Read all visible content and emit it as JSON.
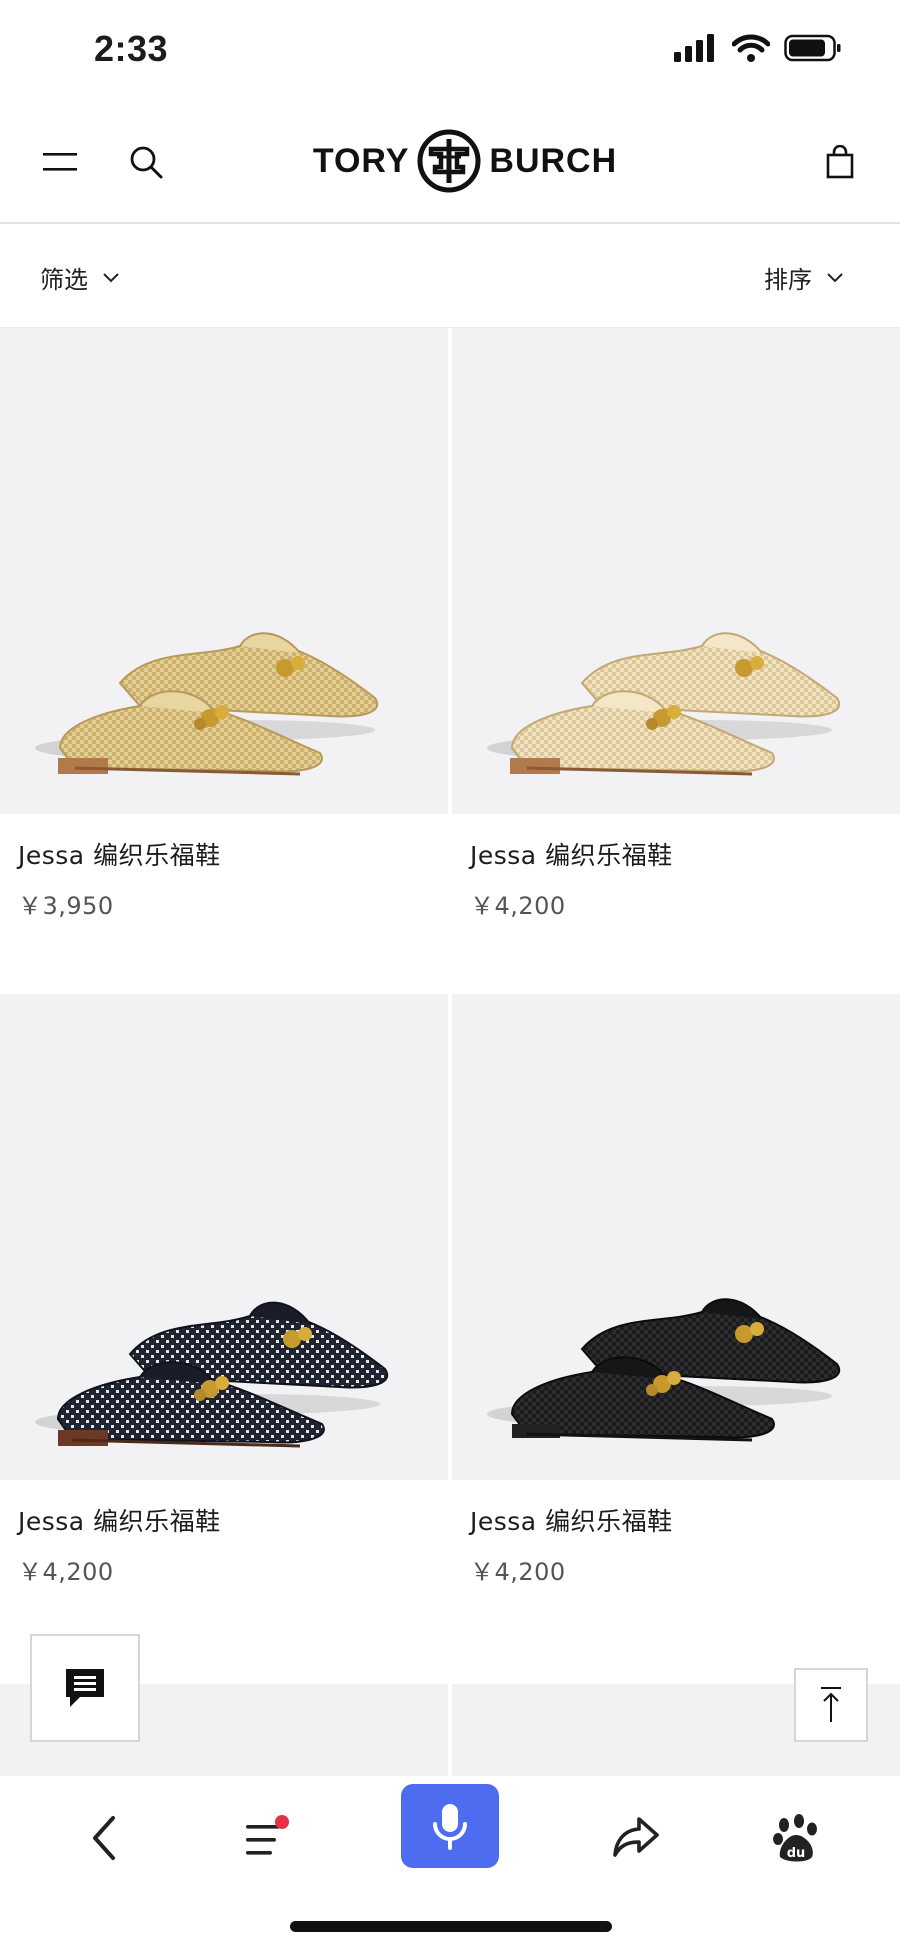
{
  "status": {
    "time": "2:33"
  },
  "header": {
    "brand_left": "TORY",
    "brand_right": "BURCH"
  },
  "filters": {
    "filter_label": "筛选",
    "sort_label": "排序"
  },
  "products": [
    {
      "name": "Jessa 编织乐福鞋",
      "price": "￥3,950",
      "color": "natural"
    },
    {
      "name": "Jessa 编织乐福鞋",
      "price": "￥4,200",
      "color": "cream"
    },
    {
      "name": "Jessa 编织乐福鞋",
      "price": "￥4,200",
      "color": "navy-white"
    },
    {
      "name": "Jessa 编织乐福鞋",
      "price": "￥4,200",
      "color": "black"
    }
  ],
  "icons": {
    "menu": "hamburger-icon",
    "search": "search-icon",
    "bag": "shopping-bag-icon",
    "chat": "chat-icon",
    "top": "back-to-top-icon",
    "back": "back-chevron-icon",
    "tabs": "menu-lines-icon",
    "mic": "microphone-icon",
    "share": "share-icon",
    "baidu": "baidu-paw-icon"
  },
  "colors": {
    "mic_button": "#4d6cf0",
    "notification_dot": "#e8304a",
    "image_bg": "#f2f2f4"
  }
}
